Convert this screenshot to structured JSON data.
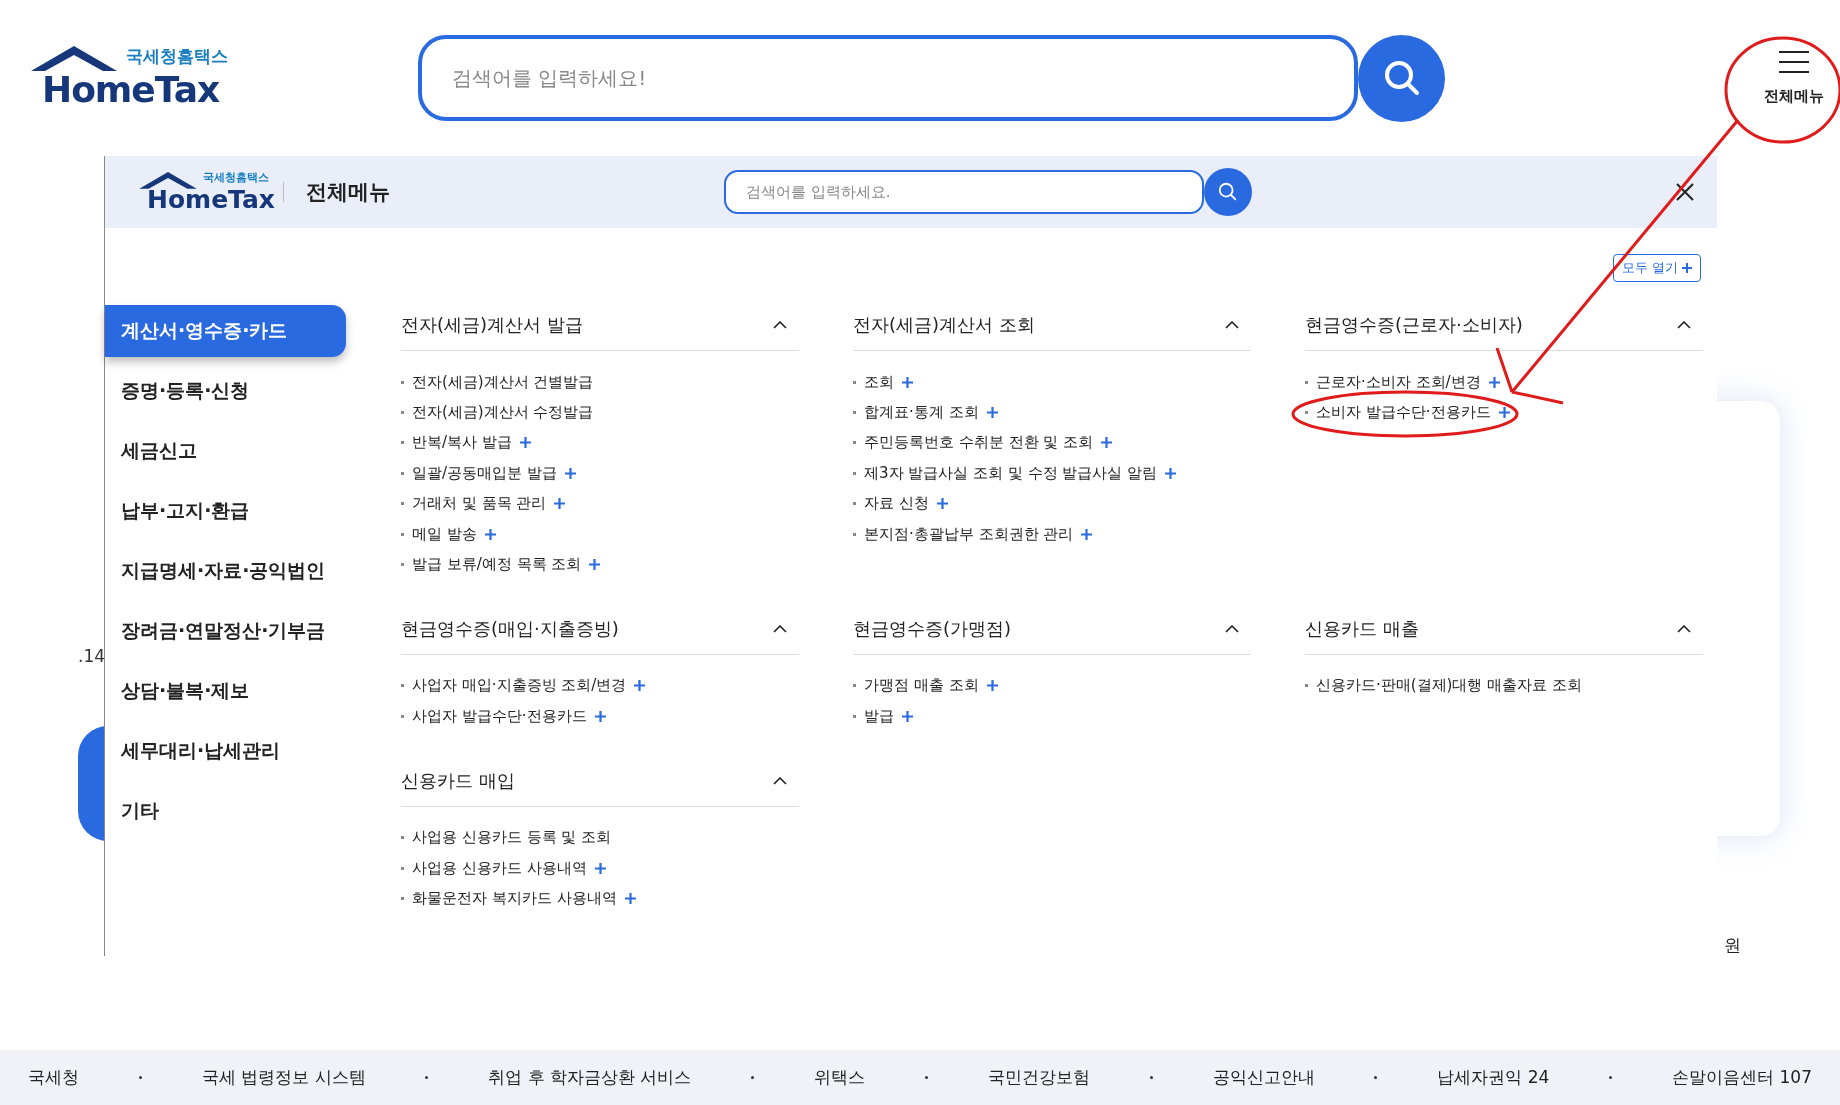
{
  "header": {
    "logo": {
      "small": "국세청홈택스",
      "big": "HomeTax"
    },
    "search": {
      "placeholder": "검색어를 입력하세요!"
    },
    "menu_button": "전체메뉴"
  },
  "page_behind": {
    "texts": [
      ".14",
      "원"
    ]
  },
  "menu_panel": {
    "logo": {
      "small": "국세청홈택스",
      "big": "HomeTax"
    },
    "title": "전체메뉴",
    "search": {
      "placeholder": "검색어를 입력하세요."
    },
    "open_all": "모두 열기",
    "sidebar": [
      {
        "label": "계산서·영수증·카드",
        "selected": true
      },
      {
        "label": "증명·등록·신청",
        "selected": false
      },
      {
        "label": "세금신고",
        "selected": false
      },
      {
        "label": "납부·고지·환급",
        "selected": false
      },
      {
        "label": "지급명세·자료·공익법인",
        "selected": false
      },
      {
        "label": "장려금·연말정산·기부금",
        "selected": false
      },
      {
        "label": "상담·불복·제보",
        "selected": false
      },
      {
        "label": "세무대리·납세관리",
        "selected": false
      },
      {
        "label": "기타",
        "selected": false
      }
    ],
    "sections": [
      {
        "title": "전자(세금)계산서 발급",
        "expanded": true,
        "items": [
          {
            "label": "전자(세금)계산서 건별발급",
            "expandable": false
          },
          {
            "label": "전자(세금)계산서 수정발급",
            "expandable": false
          },
          {
            "label": "반복/복사 발급",
            "expandable": true
          },
          {
            "label": "일괄/공동매입분 발급",
            "expandable": true
          },
          {
            "label": "거래처 및 품목 관리",
            "expandable": true
          },
          {
            "label": "메일 발송",
            "expandable": true
          },
          {
            "label": "발급 보류/예정 목록 조회",
            "expandable": true
          }
        ]
      },
      {
        "title": "전자(세금)계산서 조회",
        "expanded": true,
        "items": [
          {
            "label": "조회",
            "expandable": true
          },
          {
            "label": "합계표·통계 조회",
            "expandable": true
          },
          {
            "label": "주민등록번호 수취분 전환 및 조회",
            "expandable": true
          },
          {
            "label": "제3자 발급사실 조회 및 수정 발급사실 알림",
            "expandable": true
          },
          {
            "label": "자료 신청",
            "expandable": true
          },
          {
            "label": "본지점·총괄납부 조회권한 관리",
            "expandable": true
          }
        ]
      },
      {
        "title": "현금영수증(근로자·소비자)",
        "expanded": true,
        "items": [
          {
            "label": "근로자·소비자 조회/변경",
            "expandable": true
          },
          {
            "label": "소비자 발급수단·전용카드",
            "expandable": true
          }
        ]
      },
      {
        "title": "현금영수증(매입·지출증빙)",
        "expanded": true,
        "items": [
          {
            "label": "사업자 매입·지출증빙 조회/변경",
            "expandable": true
          },
          {
            "label": "사업자 발급수단·전용카드",
            "expandable": true
          }
        ]
      },
      {
        "title": "현금영수증(가맹점)",
        "expanded": true,
        "items": [
          {
            "label": "가맹점 매출 조회",
            "expandable": true
          },
          {
            "label": "발급",
            "expandable": true
          }
        ]
      },
      {
        "title": "신용카드 매출",
        "expanded": true,
        "items": [
          {
            "label": "신용카드·판매(결제)대행 매출자료 조회",
            "expandable": false
          }
        ]
      },
      {
        "title": "신용카드 매입",
        "expanded": true,
        "items": [
          {
            "label": "사업용 신용카드 등록 및 조회",
            "expandable": false
          },
          {
            "label": "사업용 신용카드 사용내역",
            "expandable": true
          },
          {
            "label": "화물운전자 복지카드 사용내역",
            "expandable": true
          }
        ]
      }
    ]
  },
  "footer_links": [
    "국세청",
    "국세 법령정보 시스템",
    "취업 후 학자금상환 서비스",
    "위택스",
    "국민건강보험",
    "공익신고안내",
    "납세자권익 24",
    "손말이음센터 107"
  ]
}
